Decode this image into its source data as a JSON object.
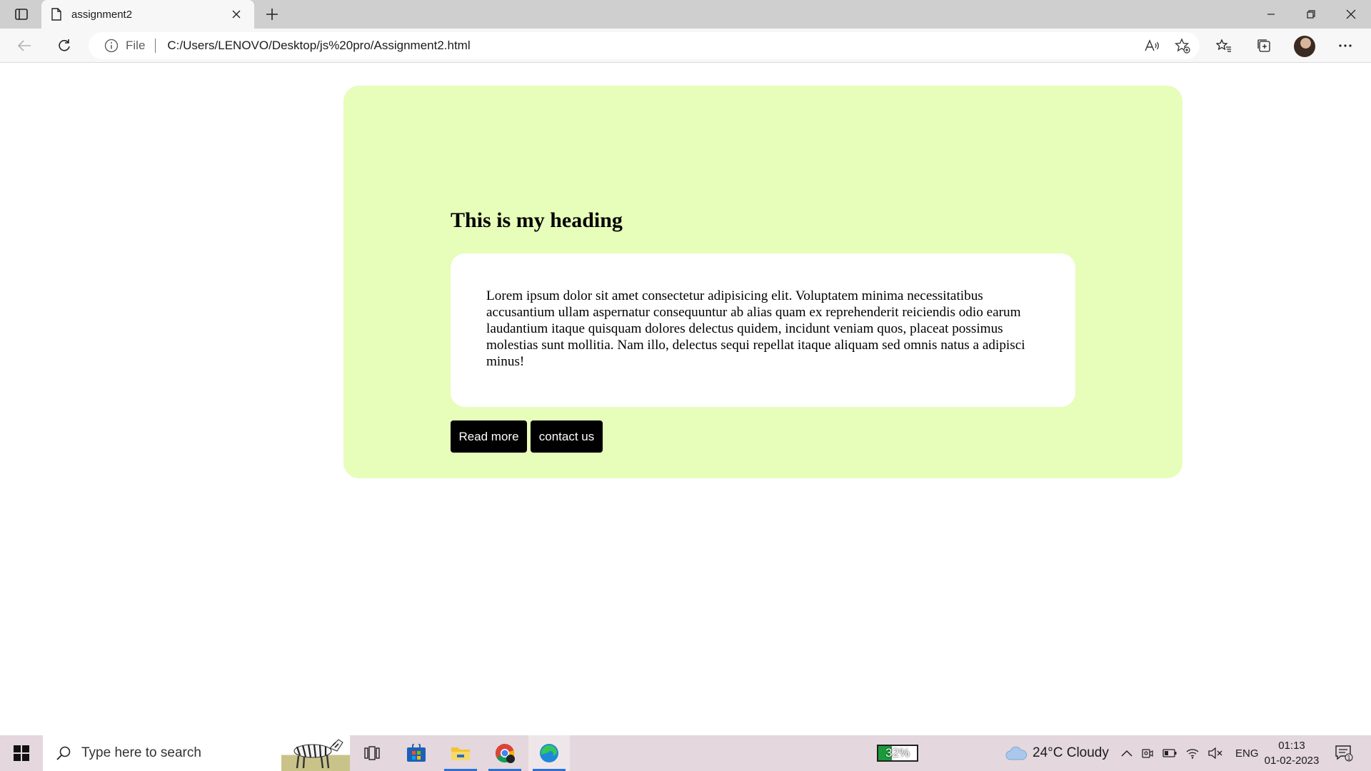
{
  "browser": {
    "tab_title": "assignment2",
    "address_prefix": "File",
    "url": "C:/Users/LENOVO/Desktop/js%20pro/Assignment2.html"
  },
  "page": {
    "heading": "This is my heading",
    "paragraph": "Lorem ipsum dolor sit amet consectetur adipisicing elit. Voluptatem minima necessitatibus accusantium ullam aspernatur consequuntur ab alias quam ex reprehenderit reiciendis odio earum laudantium itaque quisquam dolores delectus quidem, incidunt veniam quos, placeat possimus molestias sunt mollitia. Nam illo, delectus sequi repellat itaque aliquam sed omnis natus a adipisci minus!",
    "buttons": {
      "read_more": "Read more",
      "contact_us": "contact us"
    },
    "colors": {
      "card_background": "#e7fdba",
      "button_background": "#000000"
    }
  },
  "taskbar": {
    "search_placeholder": "Type here to search",
    "battery_percent": "32%",
    "weather": "24°C  Cloudy",
    "language": "ENG",
    "time": "01:13",
    "date": "01-02-2023",
    "notification_count": "1"
  }
}
